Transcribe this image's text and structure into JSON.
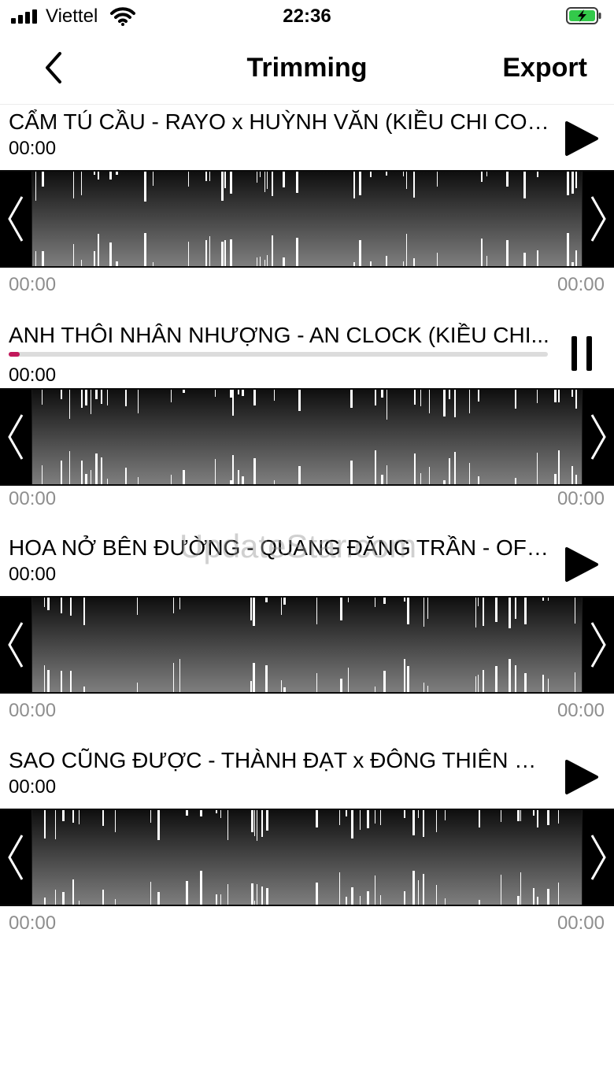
{
  "status_bar": {
    "carrier": "Viettel",
    "time": "22:36"
  },
  "nav": {
    "title": "Trimming",
    "export_label": "Export",
    "back_icon": "chevron-left-icon"
  },
  "colors": {
    "progress": "#c2185b",
    "text": "#000000",
    "muted": "#8e8e8e"
  },
  "tracks": [
    {
      "title": "CẨM TÚ CẦU - RAYO x HUỲNH VĂN (KIỀU CHI COVE...",
      "time": "00:00",
      "state": "play",
      "start": "00:00",
      "end": "00:00"
    },
    {
      "title": "ANH THÔI NHÂN NHƯỢNG - AN CLOCK (KIỀU CHI...",
      "time": "00:00",
      "state": "pause",
      "progress": 0.02,
      "start": "00:00",
      "end": "00:00"
    },
    {
      "title": "HOA NỞ BÊN ĐƯỜNG - QUANG ĐĂNG TRẦN - OFFI...",
      "time": "00:00",
      "state": "play",
      "start": "00:00",
      "end": "00:00"
    },
    {
      "title": "SAO CŨNG ĐƯỢC - THÀNH ĐẠT x ĐÔNG THIÊN ĐỨ...",
      "time": "00:00",
      "state": "play",
      "start": "00:00",
      "end": "00:00"
    }
  ],
  "watermark": "UpdateStar.com"
}
